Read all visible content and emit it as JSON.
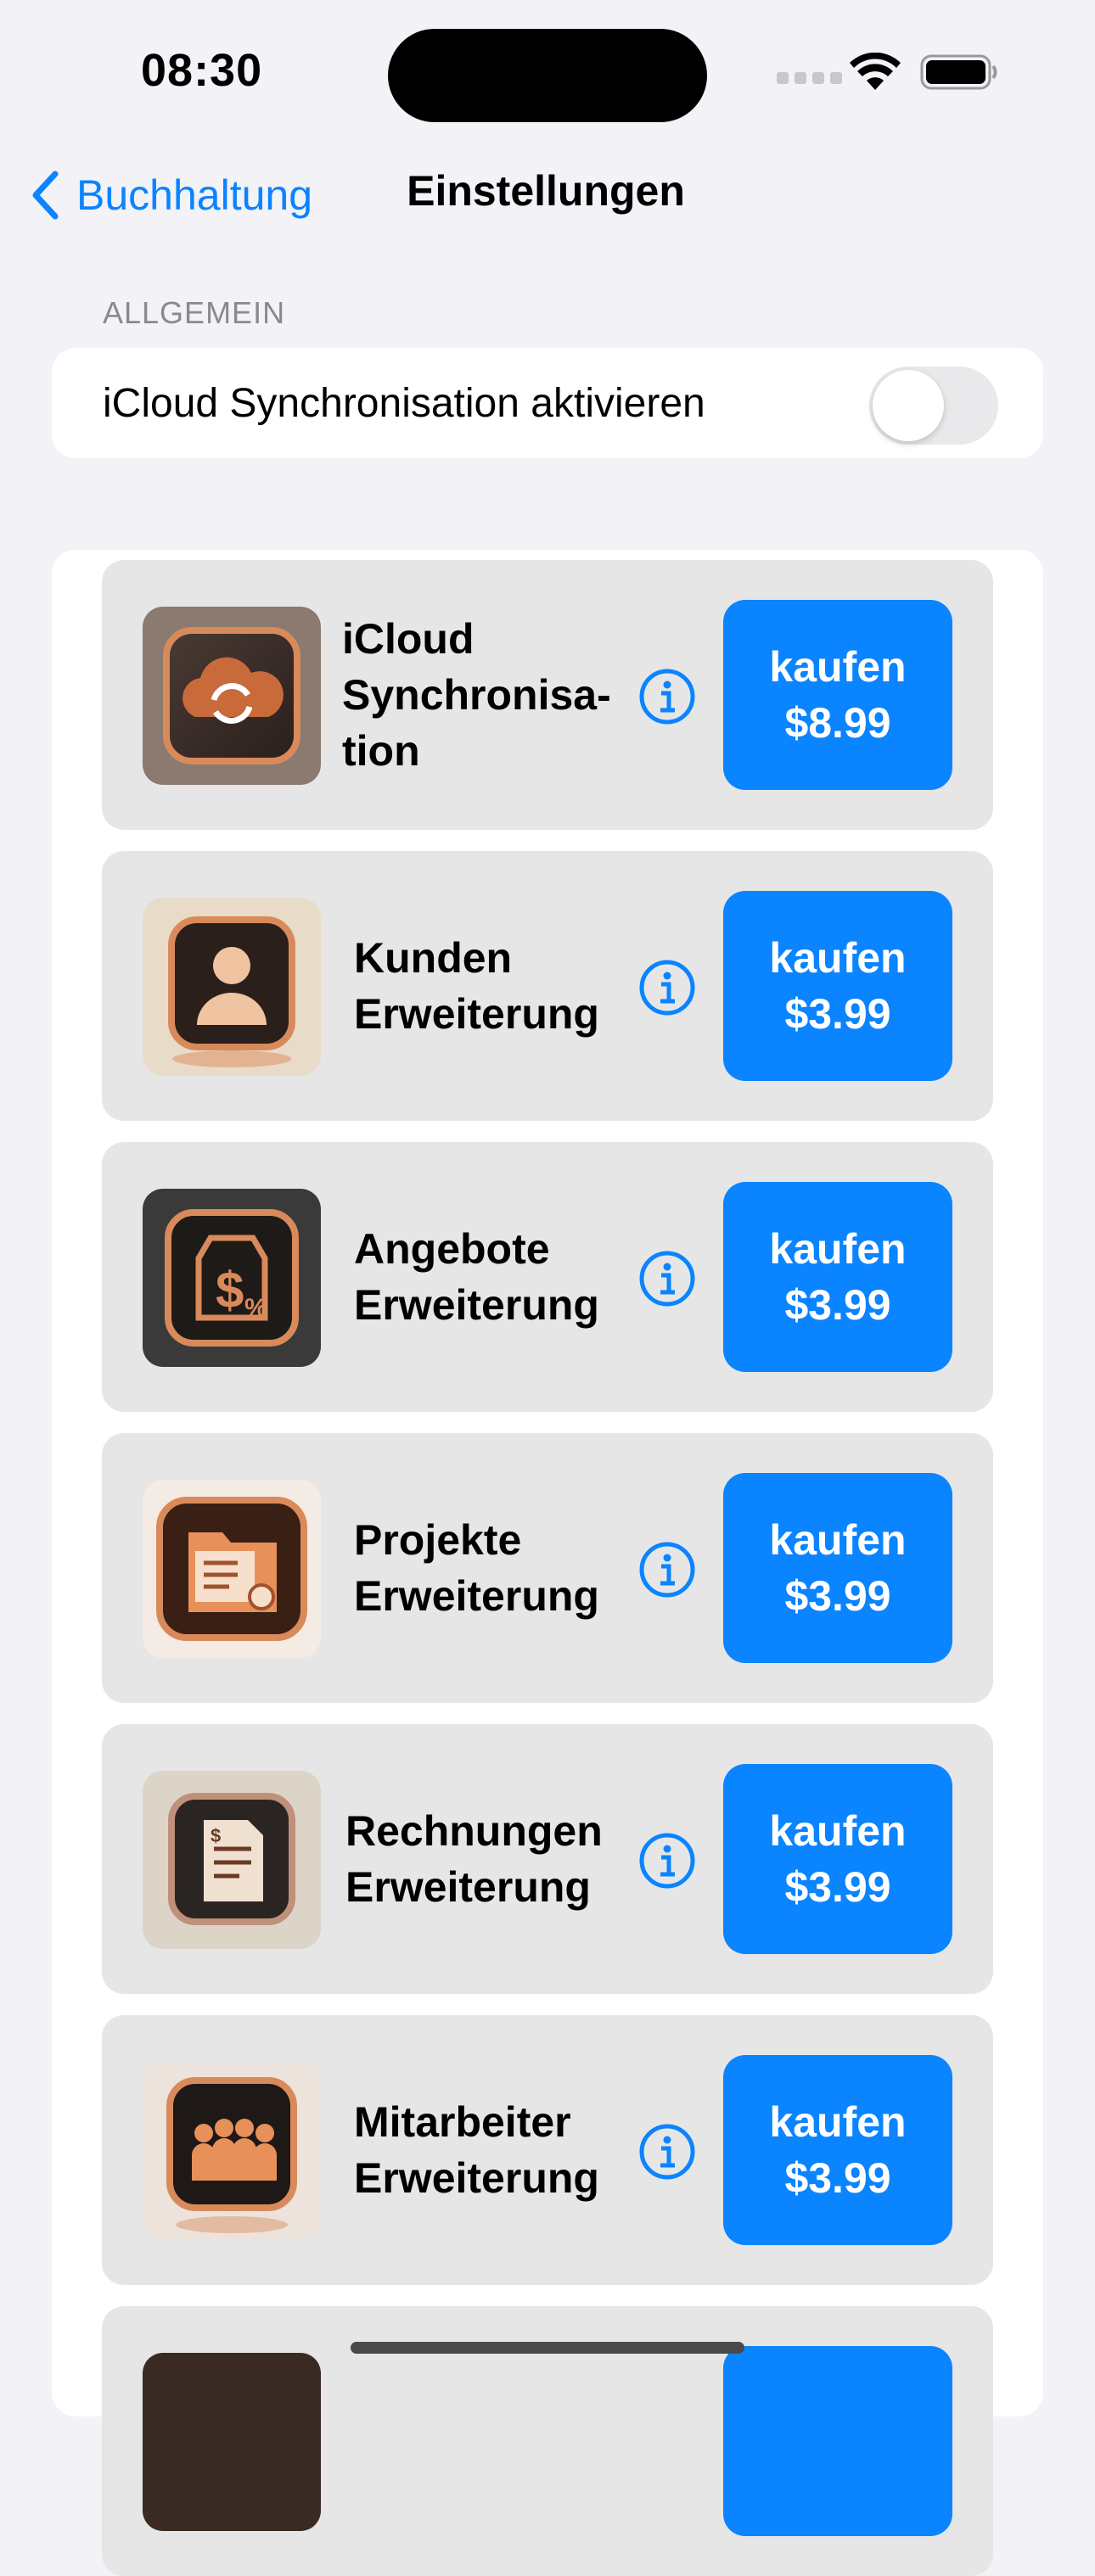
{
  "status_bar": {
    "time": "08:30"
  },
  "nav": {
    "back_label": "Buchhaltung",
    "title": "Einstellungen"
  },
  "sections": {
    "general": {
      "header": "ALLGEMEIN",
      "icloud_toggle_label": "iCloud Synchronisation aktivieren",
      "icloud_toggle_on": false
    }
  },
  "products": [
    {
      "name": "iCloud\nSynchronisa-\ntion",
      "buy_label": "kaufen",
      "price": "$8.99",
      "icon": "cloud-sync-icon"
    },
    {
      "name": "Kunden\nErweiterung",
      "buy_label": "kaufen",
      "price": "$3.99",
      "icon": "customer-icon"
    },
    {
      "name": "Angebote\nErweiterung",
      "buy_label": "kaufen",
      "price": "$3.99",
      "icon": "price-tag-icon"
    },
    {
      "name": "Projekte\nErweiterung",
      "buy_label": "kaufen",
      "price": "$3.99",
      "icon": "project-folder-icon"
    },
    {
      "name": "Rechnungen\nErweiterung",
      "buy_label": "kaufen",
      "price": "$3.99",
      "icon": "invoice-icon"
    },
    {
      "name": "Mitarbeiter\nErweiterung",
      "buy_label": "kaufen",
      "price": "$3.99",
      "icon": "employees-icon"
    }
  ],
  "colors": {
    "accent": "#0a84ff",
    "background": "#f2f2f7",
    "card": "#e6e6e6",
    "copper": "#c86a3a"
  }
}
